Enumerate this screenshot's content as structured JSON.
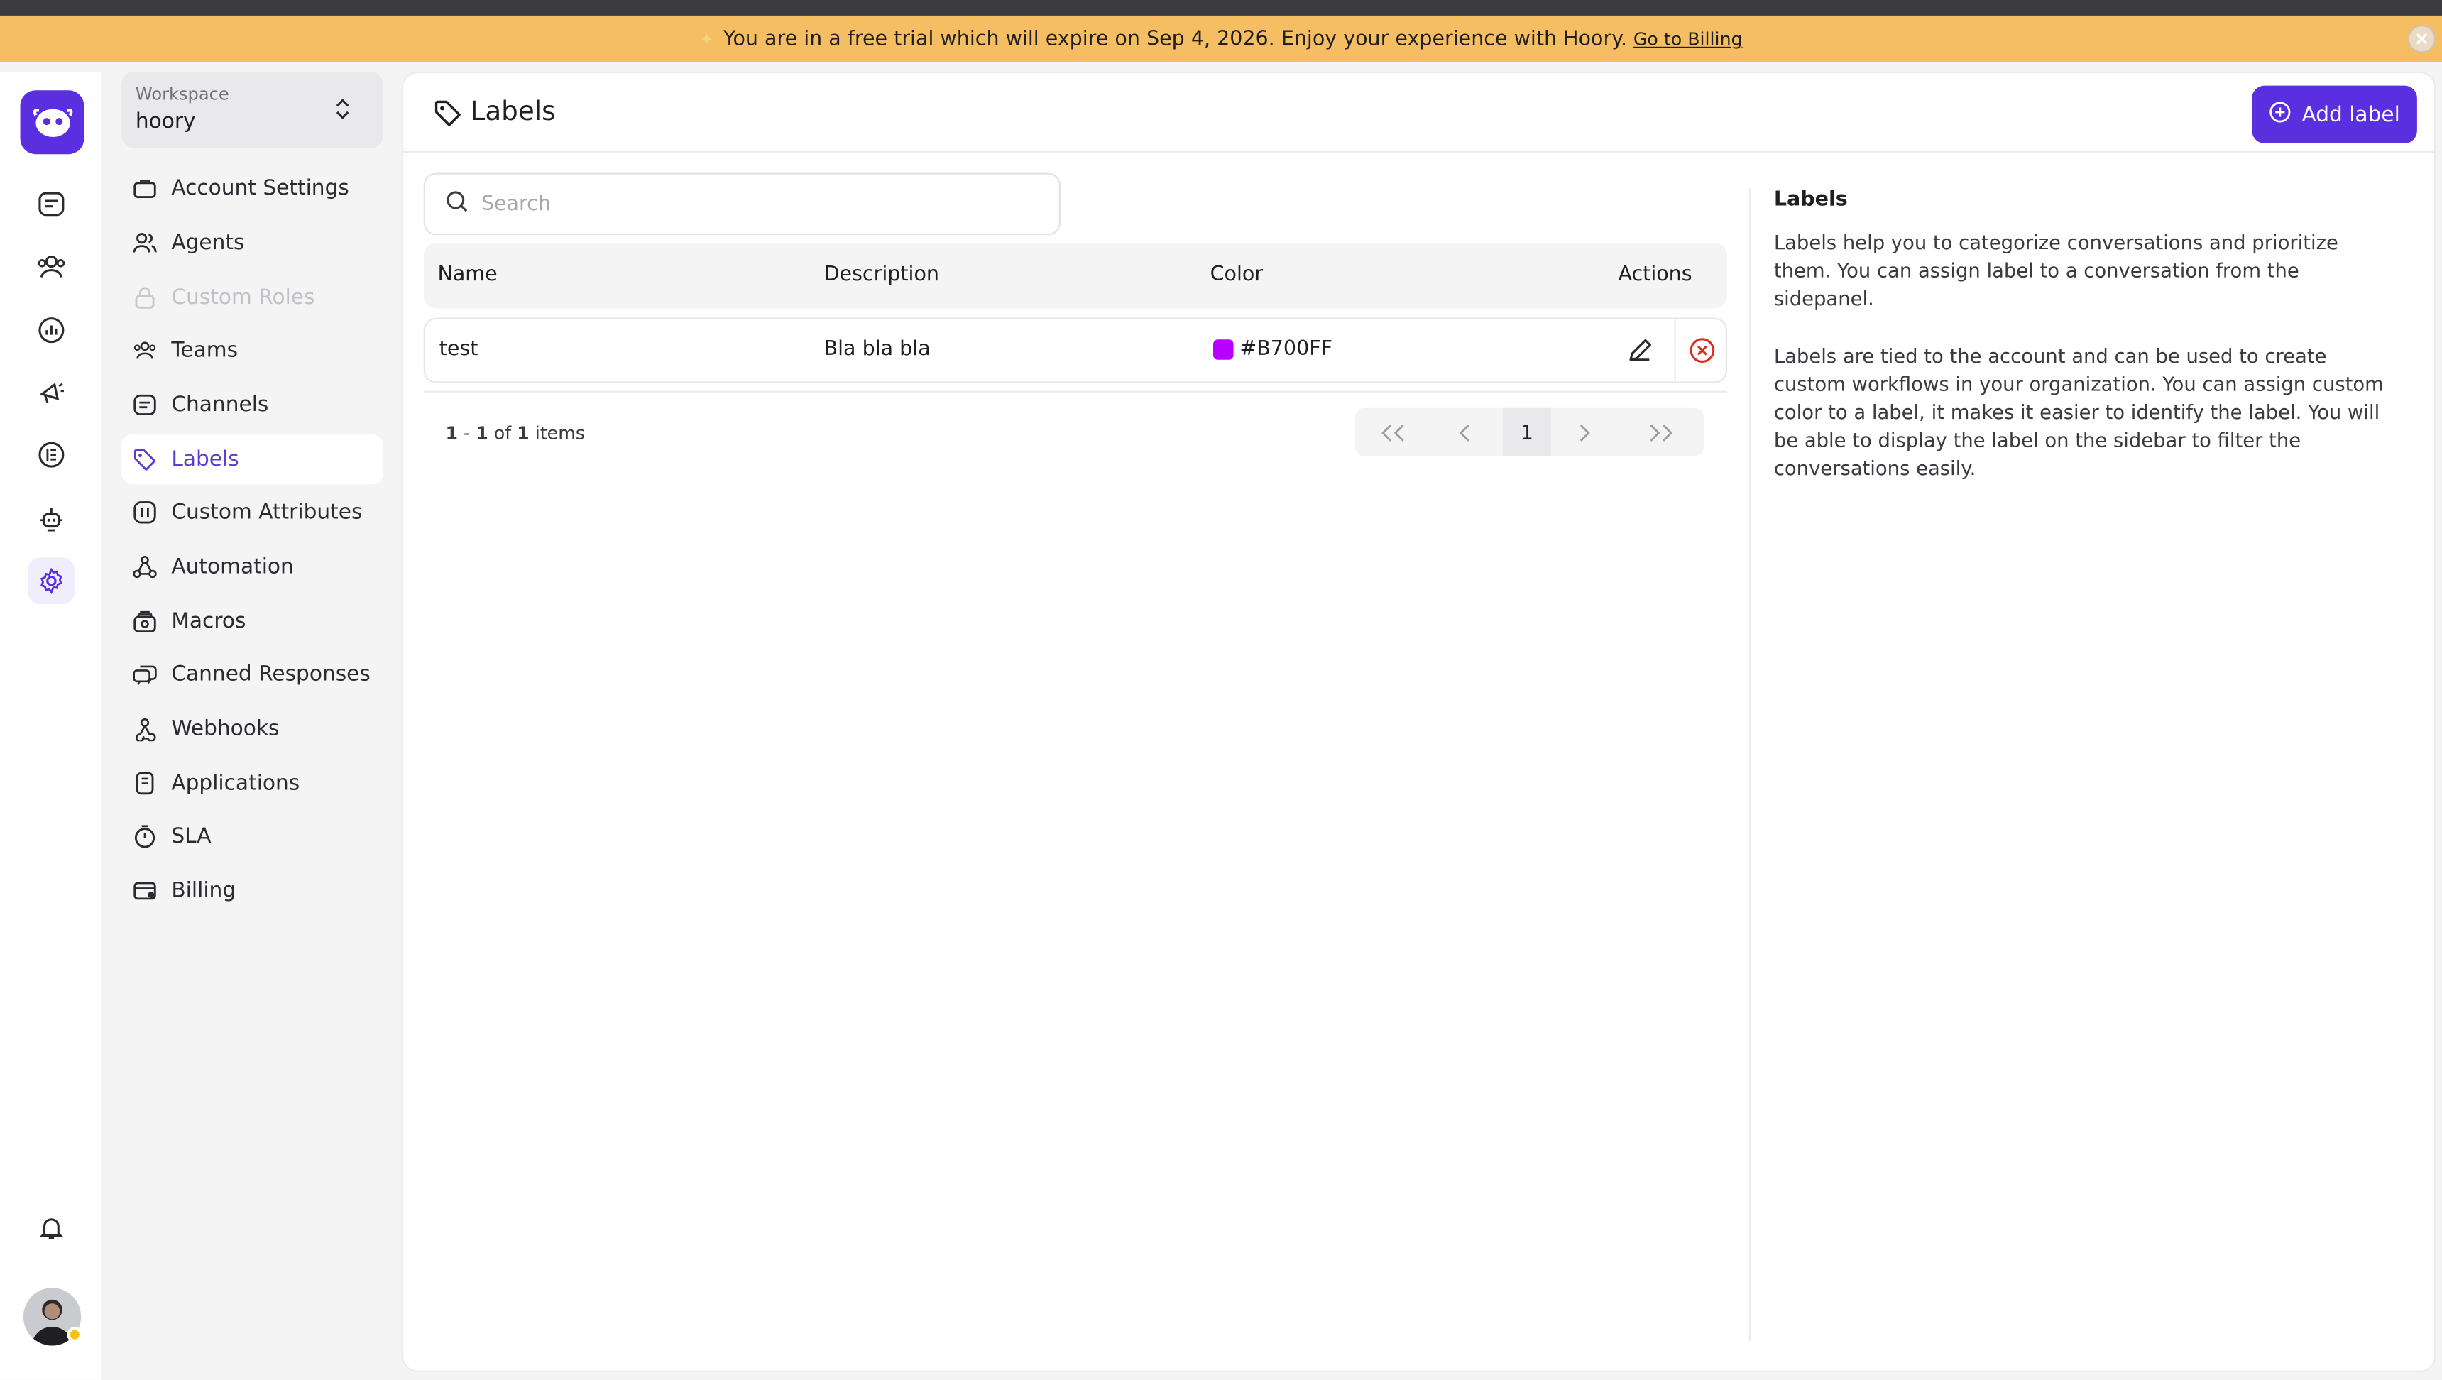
{
  "banner": {
    "message": "You are in a free trial which will expire on Sep 4, 2026. Enjoy your experience with Hoory.",
    "link": "Go to Billing",
    "spark_icon": "sparkle-icon",
    "close_icon": "close-icon"
  },
  "rail": {
    "items": [
      "conversations-icon",
      "contacts-icon",
      "reports-icon",
      "campaigns-icon",
      "help-center-icon",
      "bot-icon",
      "settings-icon"
    ],
    "bottom": [
      "notifications-icon",
      "avatar"
    ]
  },
  "workspace": {
    "label": "Workspace",
    "name": "hoory"
  },
  "sidebar": {
    "items": [
      {
        "label": "Account Settings"
      },
      {
        "label": "Agents"
      },
      {
        "label": "Custom Roles"
      },
      {
        "label": "Teams"
      },
      {
        "label": "Channels"
      },
      {
        "label": "Labels"
      },
      {
        "label": "Custom Attributes"
      },
      {
        "label": "Automation"
      },
      {
        "label": "Macros"
      },
      {
        "label": "Canned Responses"
      },
      {
        "label": "Webhooks"
      },
      {
        "label": "Applications"
      },
      {
        "label": "SLA"
      },
      {
        "label": "Billing"
      }
    ]
  },
  "page": {
    "title": "Labels",
    "add_button": "Add label",
    "search_placeholder": "Search"
  },
  "table": {
    "headers": {
      "name": "Name",
      "description": "Description",
      "color": "Color",
      "actions": "Actions"
    },
    "rows": [
      {
        "name": "test",
        "description": "Bla bla bla",
        "color": "#B700FF"
      }
    ]
  },
  "pagination": {
    "range_start": "1",
    "range_end": "1",
    "of_text": "of",
    "total": "1",
    "items_text": "items",
    "current_page": "1"
  },
  "info_panel": {
    "title": "Labels",
    "paragraph1": "Labels help you to categorize conversations and prioritize them. You can assign label to a conversation from the sidepanel.",
    "paragraph2": "Labels are tied to the account and can be used to create custom workflows in your organization. You can assign custom color to a label, it makes it easier to identify the label. You will be able to display the label on the sidebar to filter the conversations easily."
  },
  "colors": {
    "accent": "#5A2FE0",
    "banner": "#F5BE63",
    "delete": "#D92D20",
    "status_online": "#F2C21B"
  }
}
